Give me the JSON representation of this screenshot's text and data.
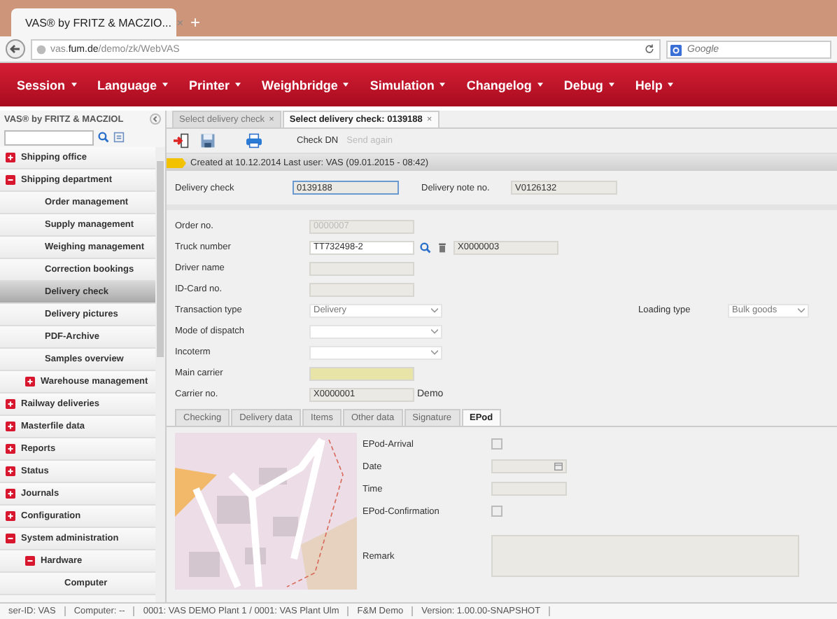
{
  "browser": {
    "tab_title": "VAS® by FRITZ & MACZIO...",
    "tab_close": "×",
    "new_tab": "+",
    "url_host": "vas.",
    "url_domain": "fum.de",
    "url_path": "/demo/zk/WebVAS",
    "search_placeholder": "Google"
  },
  "menu": [
    "Session",
    "Language",
    "Printer",
    "Weighbridge",
    "Simulation",
    "Changelog",
    "Debug",
    "Help"
  ],
  "sidebar": {
    "title": "VAS® by FRITZ & MACZIOL",
    "items": [
      {
        "label": "Shipping office",
        "expanded": false,
        "selected": false
      },
      {
        "label": "Shipping department",
        "expanded": true,
        "selected": false,
        "children": [
          {
            "label": "Order management",
            "selected": false
          },
          {
            "label": "Supply management",
            "selected": false
          },
          {
            "label": "Weighing management",
            "selected": false
          },
          {
            "label": "Correction bookings",
            "selected": false
          },
          {
            "label": "Delivery check",
            "selected": true
          },
          {
            "label": "Delivery pictures",
            "selected": false
          },
          {
            "label": "PDF-Archive",
            "selected": false
          },
          {
            "label": "Samples overview",
            "selected": false
          },
          {
            "label": "Warehouse management",
            "expanded": false,
            "selected": false
          }
        ]
      },
      {
        "label": "Railway deliveries",
        "expanded": false,
        "selected": false
      },
      {
        "label": "Masterfile data",
        "expanded": false,
        "selected": false
      },
      {
        "label": "Reports",
        "expanded": false,
        "selected": false
      },
      {
        "label": "Status",
        "expanded": false,
        "selected": false
      },
      {
        "label": "Journals",
        "expanded": false,
        "selected": false
      },
      {
        "label": "Configuration",
        "expanded": false,
        "selected": false
      },
      {
        "label": "System administration",
        "expanded": true,
        "selected": false,
        "children": [
          {
            "label": "Hardware",
            "expanded": true,
            "selected": false,
            "children": [
              {
                "label": "Computer",
                "selected": false
              }
            ]
          }
        ]
      }
    ]
  },
  "tabs": [
    {
      "label": "Select delivery check",
      "close": "×",
      "selected": false
    },
    {
      "label": "Select delivery check: 0139188",
      "close": "×",
      "selected": true
    }
  ],
  "toolbar": [
    {
      "label": "Check DN",
      "disabled": false
    },
    {
      "label": "Send again",
      "disabled": true
    }
  ],
  "info": "Created at 10.12.2014 Last user: VAS (09.01.2015 - 08:42)",
  "header": [
    {
      "label": "Delivery check",
      "value": "0139188"
    },
    {
      "label": "Delivery note no.",
      "value": "V0126132"
    }
  ],
  "form": [
    {
      "label": "Order no.",
      "kind": "readonly",
      "value": "0000007",
      "disabled": true
    },
    {
      "label": "Truck number",
      "kind": "input",
      "value": "TT732498-2",
      "lookup": "X0000003"
    },
    {
      "label": "Driver name",
      "kind": "readonly"
    },
    {
      "label": "ID-Card no.",
      "kind": "readonly"
    },
    {
      "label": "Transaction type",
      "kind": "select",
      "value": "Delivery",
      "side_label": "Loading type",
      "side_value": "Bulk goods"
    },
    {
      "label": "Mode of dispatch",
      "kind": "select"
    },
    {
      "label": "Incoterm",
      "kind": "select"
    },
    {
      "label": "Main carrier",
      "kind": "required"
    },
    {
      "label": "Carrier no.",
      "kind": "readonly",
      "value": "X0000001",
      "suffix": "Demo"
    }
  ],
  "detail_tabs": [
    {
      "label": "Checking",
      "selected": false
    },
    {
      "label": "Delivery data",
      "selected": false
    },
    {
      "label": "Items",
      "selected": false
    },
    {
      "label": "Other data",
      "selected": false
    },
    {
      "label": "Signature",
      "selected": false
    },
    {
      "label": "EPod",
      "selected": true
    }
  ],
  "epod": [
    {
      "label": "EPod-Arrival",
      "kind": "checkbox",
      "checked": false
    },
    {
      "label": "Date",
      "kind": "date"
    },
    {
      "label": "Time",
      "kind": "text"
    },
    {
      "label": "EPod-Confirmation",
      "kind": "checkbox",
      "checked": false
    },
    {
      "label": "Remark",
      "kind": "textarea"
    }
  ],
  "status_bar": [
    "ser-ID: VAS",
    "Computer: --",
    "0001: VAS DEMO Plant 1 / 0001: VAS Plant Ulm",
    "F&M Demo",
    "Version: 1.00.00-SNAPSHOT"
  ]
}
